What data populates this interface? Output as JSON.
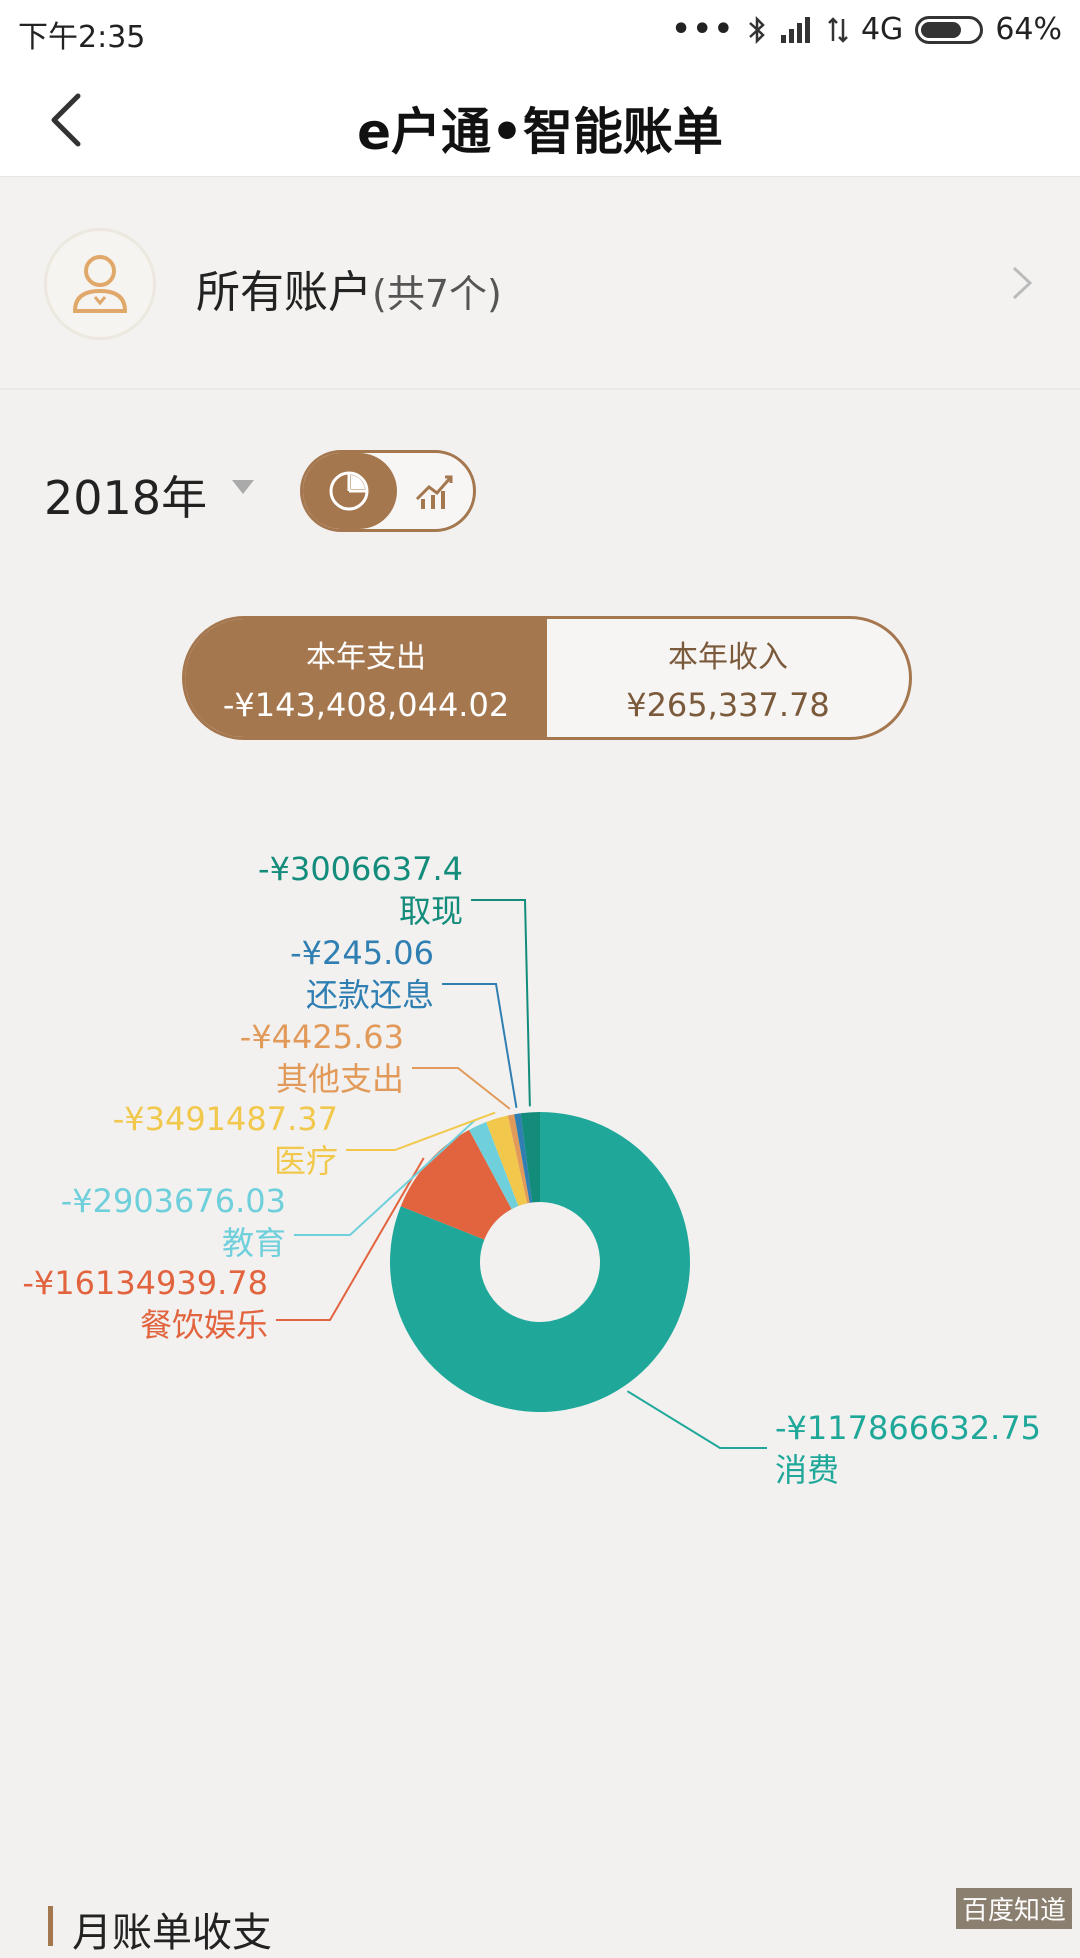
{
  "status_bar": {
    "time": "下午2:35",
    "network": "4G",
    "battery": "64%"
  },
  "nav": {
    "title": "e户通•智能账单"
  },
  "account": {
    "name": "所有账户",
    "count": "(共7个)"
  },
  "filters": {
    "year": "2018年"
  },
  "totals": {
    "expense_label": "本年支出",
    "expense_value": "-¥143,408,044.02",
    "income_label": "本年收入",
    "income_value": "¥265,337.78"
  },
  "chart_data": {
    "type": "pie",
    "donut": true,
    "slices": [
      {
        "label": "消费",
        "display": "-¥117866632.75",
        "value": 117866632.75,
        "color": "#1fa89a"
      },
      {
        "label": "餐饮娱乐",
        "display": "-¥16134939.78",
        "value": 16134939.78,
        "color": "#e2643f"
      },
      {
        "label": "教育",
        "display": "-¥2903676.03",
        "value": 2903676.03,
        "color": "#6fd0dc"
      },
      {
        "label": "医疗",
        "display": "-¥3491487.37",
        "value": 3491487.37,
        "color": "#f1c84b"
      },
      {
        "label": "其他支出",
        "display": "-¥4425.63",
        "value": 4425.63,
        "color": "#e19a5a"
      },
      {
        "label": "还款还息",
        "display": "-¥245.06",
        "value": 245.06,
        "color": "#2f7fb3"
      },
      {
        "label": "取现",
        "display": "-¥3006637.4",
        "value": 3006637.4,
        "color": "#138c7c"
      }
    ]
  },
  "section": {
    "title": "月账单收支"
  },
  "watermark": "百度知道"
}
